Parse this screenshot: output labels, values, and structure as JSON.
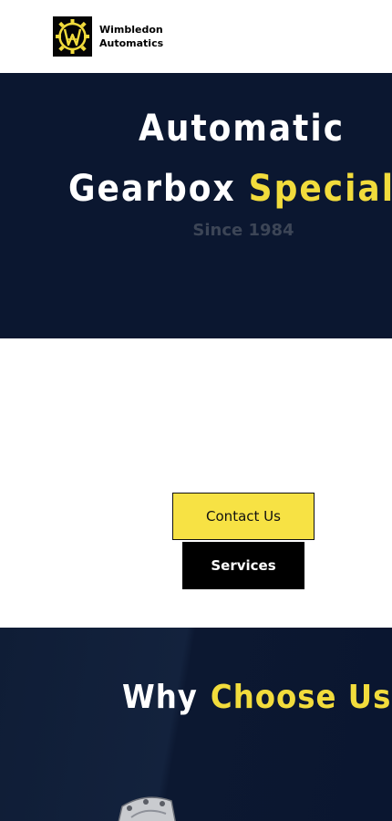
{
  "header": {
    "brand_line1": "Wimbledon",
    "brand_line2": "Automatics",
    "logo_icon": "wimbledon-automatics-gear-logo"
  },
  "hero": {
    "title_line1": "Automatic",
    "title_word1": "Gearbox",
    "title_word2": "Specialist",
    "since": "Since 1984"
  },
  "actions": {
    "contact_label": "Contact Us",
    "services_label": "Services"
  },
  "why": {
    "title_word1": "Why",
    "title_word2": "Choose Us",
    "image_icon": "gearbox-image"
  },
  "colors": {
    "navy": "#0b1730",
    "accent_yellow": "#f2dc3c",
    "button_yellow": "#f7e244",
    "black": "#000000",
    "white": "#ffffff"
  }
}
